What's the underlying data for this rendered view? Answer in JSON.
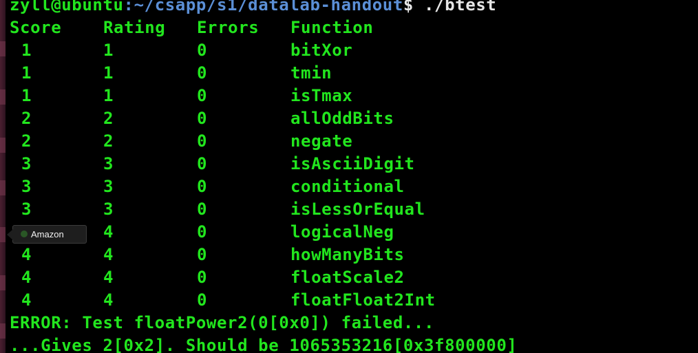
{
  "prompt": {
    "user_host": "zyll@ubuntu",
    "separator": ":",
    "path": "~/csapp/s1/datalab-handout",
    "symbol": "$",
    "command": " ./btest"
  },
  "table": {
    "headers": [
      "Score",
      "Rating",
      "Errors",
      "Function"
    ],
    "rows": [
      {
        "score": "1",
        "rating": "1",
        "errors": "0",
        "function": "bitXor"
      },
      {
        "score": "1",
        "rating": "1",
        "errors": "0",
        "function": "tmin"
      },
      {
        "score": "1",
        "rating": "1",
        "errors": "0",
        "function": "isTmax"
      },
      {
        "score": "2",
        "rating": "2",
        "errors": "0",
        "function": "allOddBits"
      },
      {
        "score": "2",
        "rating": "2",
        "errors": "0",
        "function": "negate"
      },
      {
        "score": "3",
        "rating": "3",
        "errors": "0",
        "function": "isAsciiDigit"
      },
      {
        "score": "3",
        "rating": "3",
        "errors": "0",
        "function": "conditional"
      },
      {
        "score": "3",
        "rating": "3",
        "errors": "0",
        "function": "isLessOrEqual"
      },
      {
        "score": "4",
        "rating": "4",
        "errors": "0",
        "function": "logicalNeg"
      },
      {
        "score": "4",
        "rating": "4",
        "errors": "0",
        "function": "howManyBits"
      },
      {
        "score": "4",
        "rating": "4",
        "errors": "0",
        "function": "floatScale2"
      },
      {
        "score": "4",
        "rating": "4",
        "errors": "0",
        "function": "floatFloat2Int"
      }
    ]
  },
  "output": {
    "error_line": "ERROR: Test floatPower2(0[0x0]) failed...",
    "gives_line": "...Gives 2[0x2]. Should be 1065353216[0x3f800000]"
  },
  "tooltip": {
    "label": "Amazon",
    "icon": "amazon-icon"
  },
  "colors": {
    "terminal_bg": "#000000",
    "text_green": "#22e61e",
    "path_blue": "#5b8fd6",
    "command_white": "#e6e6e6"
  }
}
